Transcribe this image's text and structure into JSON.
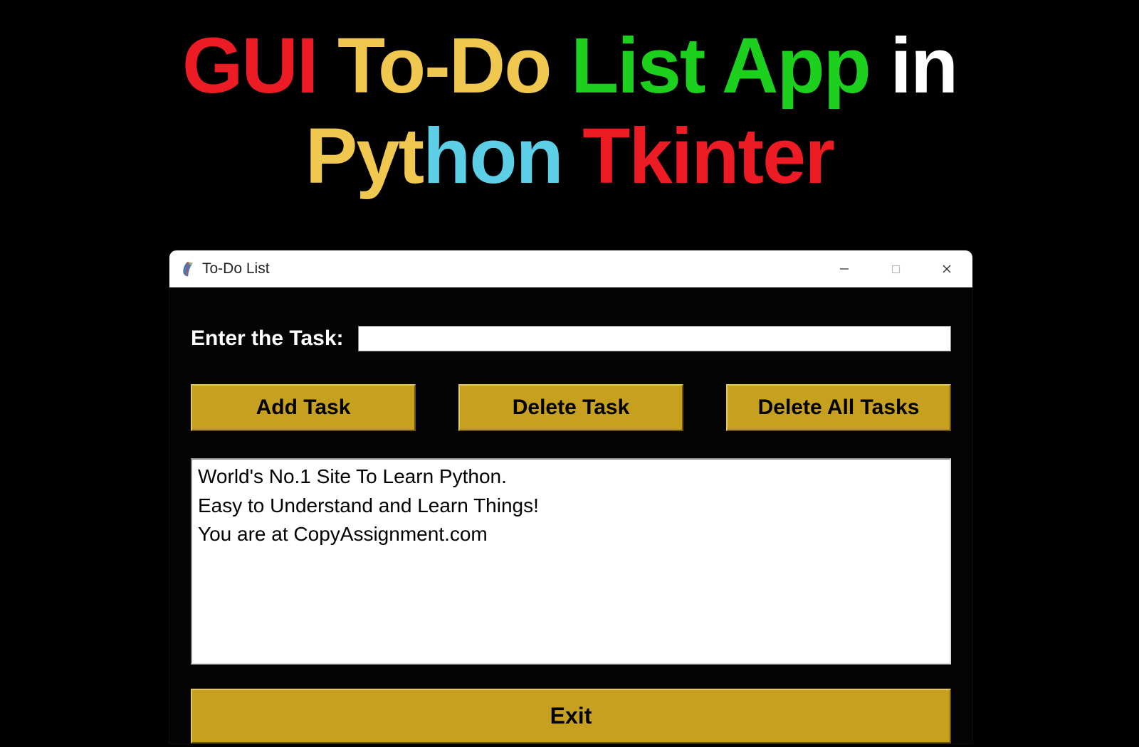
{
  "banner": {
    "w1": "GUI",
    "w2": "To-Do",
    "w3": "List",
    "w4": "App",
    "w5": "in",
    "w6a": "Pyt",
    "w6b": "hon",
    "w7": "Tkinter"
  },
  "window": {
    "title": "To-Do List",
    "minimize": "—",
    "maximize": "▢",
    "close": "✕"
  },
  "form": {
    "label": "Enter the Task:",
    "input_value": ""
  },
  "buttons": {
    "add": "Add Task",
    "delete": "Delete Task",
    "delete_all": "Delete All Tasks",
    "exit": "Exit"
  },
  "tasks": [
    "World's No.1 Site To Learn Python.",
    "Easy to Understand and Learn Things!",
    "You are at CopyAssignment.com"
  ]
}
